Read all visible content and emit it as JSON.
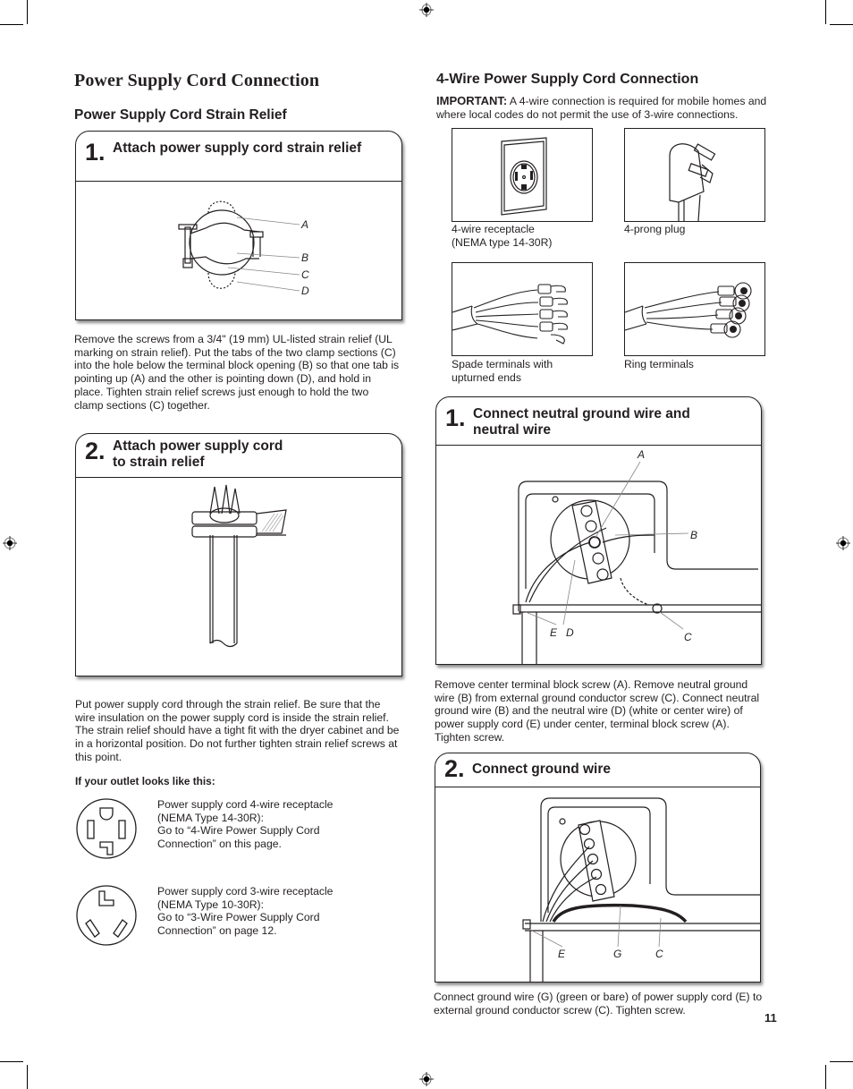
{
  "page": {
    "title": "Power Supply Cord Connection",
    "page_number": "11"
  },
  "left": {
    "subtitle": "Power Supply Cord Strain Relief",
    "step1": {
      "number": "1.",
      "title": "Attach power supply cord strain relief",
      "labels": [
        "A",
        "B",
        "C",
        "D"
      ],
      "text": "Remove the screws from a 3/4\" (19 mm) UL-listed strain relief (UL marking on strain relief). Put the tabs of the two clamp sections (C) into the hole below the terminal block opening (B) so that one tab is pointing up (A) and the other is pointing down (D), and hold in place. Tighten strain relief screws just enough to hold the two clamp sections (C) together."
    },
    "step2": {
      "number": "2.",
      "title_line1": "Attach power supply cord",
      "title_line2": "to strain relief",
      "text": "Put power supply cord through the strain relief. Be sure that the wire insulation on the power supply cord is inside the strain relief. The strain relief should have a tight fit with the dryer cabinet and be in a horizontal position. Do not further tighten strain relief screws at this point."
    },
    "outlet_heading": "If your outlet looks like this:",
    "outlets": [
      {
        "icon": "4-wire-receptacle-icon",
        "lines": [
          "Power supply cord 4-wire receptacle",
          "(NEMA Type 14-30R):",
          "Go to “4-Wire Power Supply Cord",
          "Connection” on this page."
        ]
      },
      {
        "icon": "3-wire-receptacle-icon",
        "lines": [
          "Power supply cord 3-wire receptacle",
          "(NEMA Type 10-30R):",
          "Go to “3-Wire Power Supply Cord",
          "Connection” on page 12."
        ]
      }
    ]
  },
  "right": {
    "subtitle": "4-Wire Power Supply Cord Connection",
    "important_label": "IMPORTANT:",
    "important_text": " A 4-wire connection is required for mobile homes and where local codes do not permit the use of 3-wire connections.",
    "figures": [
      {
        "caption_lines": [
          "4-wire receptacle",
          "(NEMA type 14-30R)"
        ]
      },
      {
        "caption_lines": [
          "4-prong plug"
        ]
      },
      {
        "caption_lines": [
          "Spade terminals with",
          "upturned ends"
        ]
      },
      {
        "caption_lines": [
          "Ring terminals"
        ]
      }
    ],
    "step1": {
      "number": "1.",
      "title": "Connect neutral ground wire and neutral wire",
      "labels": [
        "A",
        "B",
        "C",
        "D",
        "E"
      ],
      "text": "Remove center terminal block screw (A). Remove neutral ground wire (B) from external ground conductor screw (C). Connect neutral ground wire (B) and the neutral wire (D) (white or center wire) of power supply cord (E) under center, terminal block screw (A). Tighten screw."
    },
    "step2": {
      "number": "2.",
      "title": "Connect ground wire",
      "labels": [
        "E",
        "G",
        "C"
      ],
      "text": "Connect ground wire (G) (green or bare) of power supply cord (E) to external ground conductor screw (C). Tighten screw."
    }
  }
}
